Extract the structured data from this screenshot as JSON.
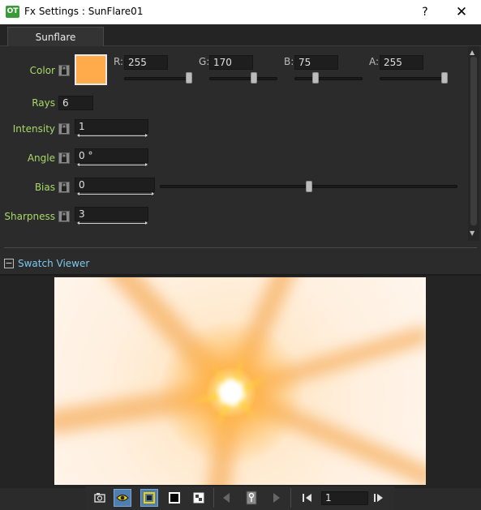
{
  "window": {
    "title": "Fx Settings : SunFlare01",
    "app_icon_text": "OT",
    "help_label": "?",
    "close_label": "✕"
  },
  "tabs": [
    {
      "label": "Sunflare",
      "active": true
    }
  ],
  "color": {
    "label": "Color",
    "swatch_hex": "#ffaa4b",
    "channels": [
      {
        "label": "R:",
        "value": "255",
        "slider_fraction": 1.0
      },
      {
        "label": "G:",
        "value": "170",
        "slider_fraction": 0.667
      },
      {
        "label": "B:",
        "value": "75",
        "slider_fraction": 0.294
      },
      {
        "label": "A:",
        "value": "255",
        "slider_fraction": 1.0
      }
    ]
  },
  "params": {
    "rays": {
      "label": "Rays",
      "value": "6"
    },
    "intensity": {
      "label": "Intensity",
      "value": "1"
    },
    "angle": {
      "label": "Angle",
      "value": "0 °"
    },
    "bias": {
      "label": "Bias",
      "value": "0",
      "slider_fraction": 0.5
    },
    "sharpness": {
      "label": "Sharpness",
      "value": "3"
    }
  },
  "swatch_viewer": {
    "title": "Swatch Viewer",
    "collapse_label": "−"
  },
  "toolbar": {
    "buttons": [
      {
        "name": "camera-view-icon",
        "active": false
      },
      {
        "name": "eye-icon",
        "active": true
      },
      {
        "name": "preview-toggle-icon",
        "active": true
      },
      {
        "name": "black-bg-icon",
        "active": false
      },
      {
        "name": "checkerboard-bg-icon",
        "active": false
      },
      {
        "name": "prev-key-icon",
        "active": false
      },
      {
        "name": "key-icon",
        "active": false
      },
      {
        "name": "next-key-icon",
        "active": false
      },
      {
        "name": "first-frame-icon",
        "active": false
      },
      {
        "name": "next-frame-icon",
        "active": false
      }
    ],
    "frame_value": "1"
  },
  "colors": {
    "label_green": "#a8d86a",
    "link_blue": "#7ec8ef",
    "panel_bg": "#2b2b2b",
    "active_blue": "#4f7fb0"
  }
}
